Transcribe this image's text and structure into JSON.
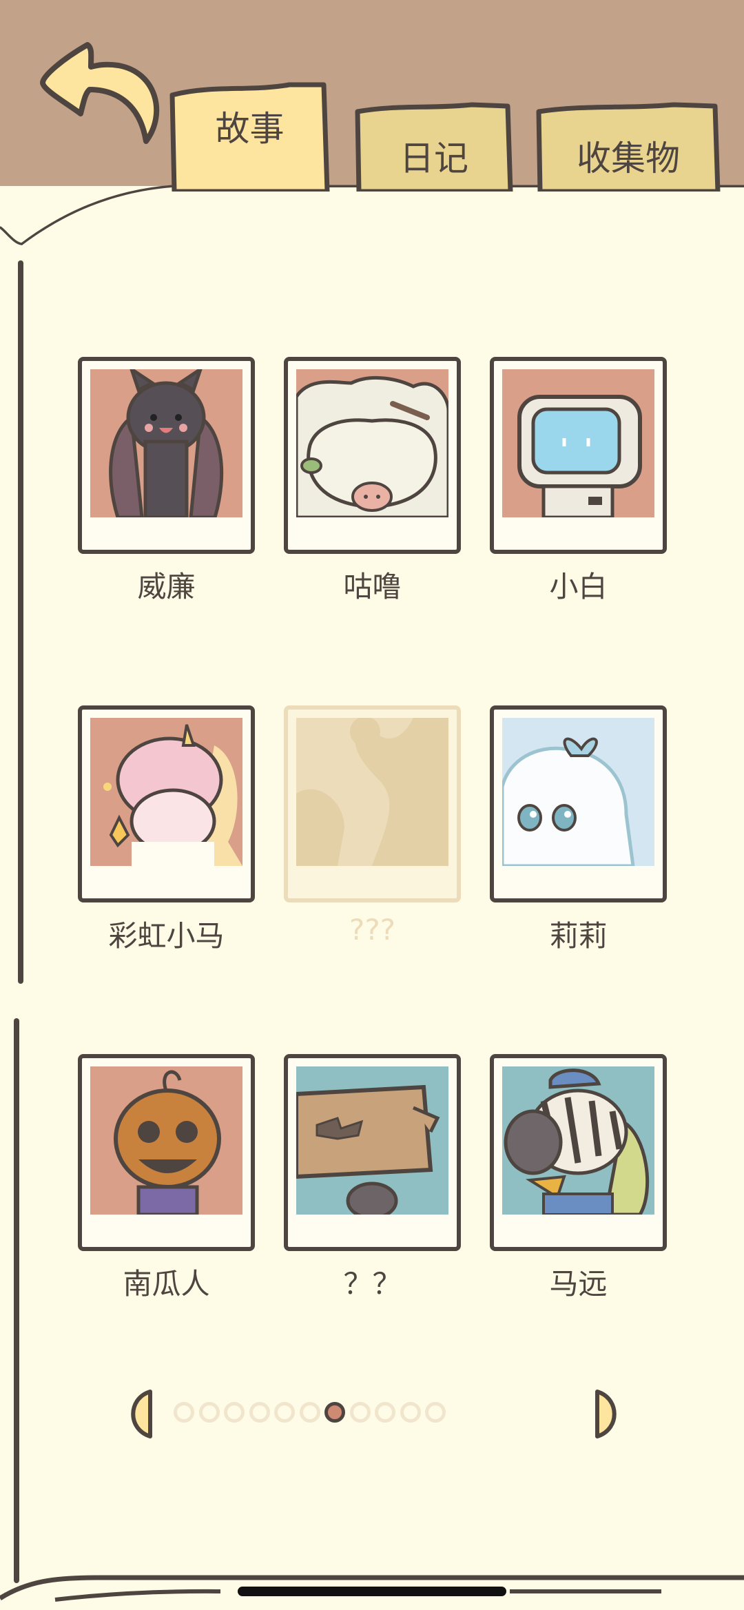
{
  "tabs": [
    {
      "label": "故事",
      "active": true
    },
    {
      "label": "日记",
      "active": false
    },
    {
      "label": "收集物",
      "active": false
    }
  ],
  "characters": [
    {
      "name": "威廉",
      "locked": false,
      "icon": "bat-character-portrait"
    },
    {
      "name": "咕噜",
      "locked": false,
      "icon": "sheep-character-portrait"
    },
    {
      "name": "小白",
      "locked": false,
      "icon": "robot-character-portrait"
    },
    {
      "name": "彩虹小马",
      "locked": false,
      "icon": "unicorn-character-portrait"
    },
    {
      "name": "???",
      "locked": true,
      "icon": "locked-silhouette-portrait"
    },
    {
      "name": "莉莉",
      "locked": false,
      "icon": "ghost-character-portrait"
    },
    {
      "name": "南瓜人",
      "locked": false,
      "icon": "pumpkin-character-portrait"
    },
    {
      "name": "？？",
      "locked": false,
      "icon": "box-character-portrait"
    },
    {
      "name": "马远",
      "locked": false,
      "icon": "zebra-character-portrait"
    }
  ],
  "pagination": {
    "total_pages": 11,
    "current_page": 7
  },
  "colors": {
    "background": "#c2a38a",
    "paper": "#fefbe6",
    "outline": "#4e4540",
    "tab_active": "#fde49f",
    "tab_inactive": "#e8d38f",
    "dot_active": "#cf8a73",
    "dot_inactive": "#f1e6cd"
  }
}
